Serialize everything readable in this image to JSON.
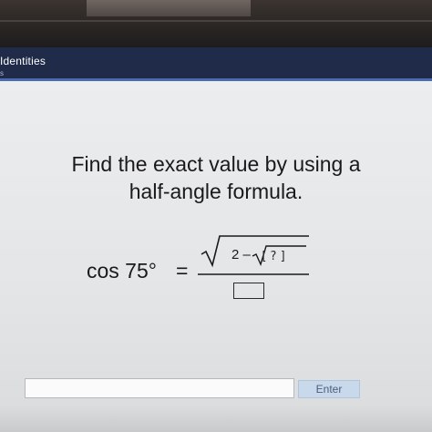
{
  "header": {
    "title": "Identities",
    "subtitle": "s"
  },
  "question": {
    "line1": "Find the exact value by using a",
    "line2": "half-angle formula."
  },
  "math": {
    "lhs": "cos 75°",
    "equals": "=",
    "numerator_prefix": "2 –",
    "inner_blank": "[ ? ]"
  },
  "answer": {
    "value": "",
    "placeholder": "",
    "enter_label": "Enter"
  },
  "colors": {
    "header_bg": "#1f2b48",
    "header_accent": "#4b6ab0",
    "content_bg": "#ebedef",
    "enter_bg": "#c9d9ec"
  }
}
